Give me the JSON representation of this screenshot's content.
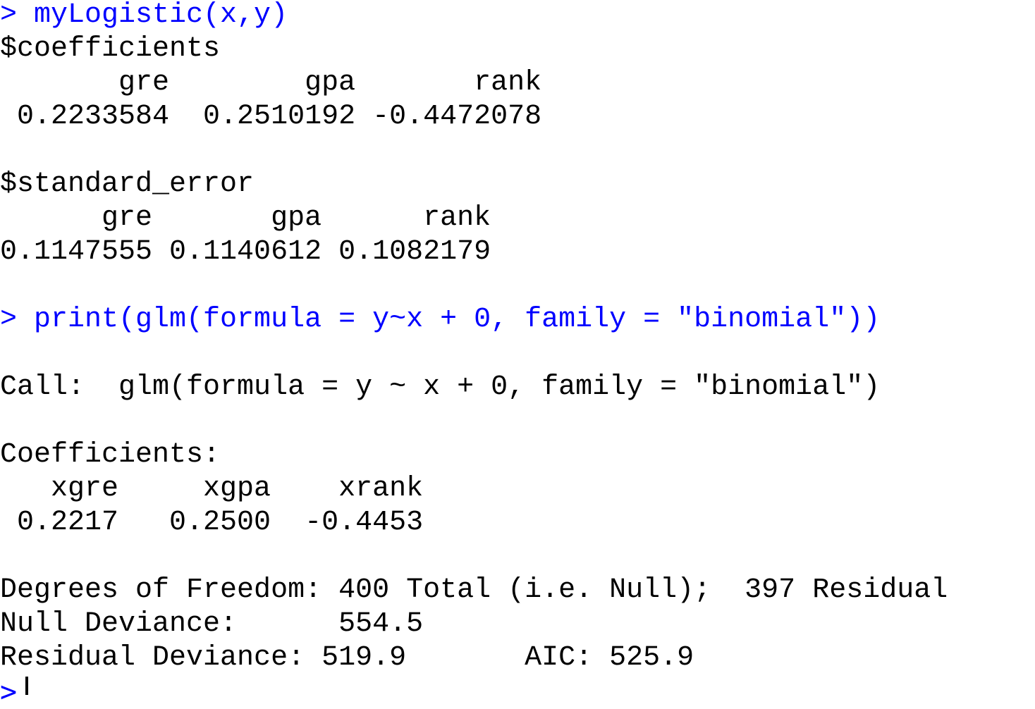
{
  "console": {
    "prompt": ">",
    "lines": [
      {
        "kind": "cmd",
        "text": "> myLogistic(x,y)"
      },
      {
        "kind": "out",
        "text": "$coefficients"
      },
      {
        "kind": "out",
        "text": "       gre        gpa       rank"
      },
      {
        "kind": "out",
        "text": " 0.2233584  0.2510192 -0.4472078"
      },
      {
        "kind": "out",
        "text": ""
      },
      {
        "kind": "out",
        "text": "$standard_error"
      },
      {
        "kind": "out",
        "text": "      gre       gpa      rank"
      },
      {
        "kind": "out",
        "text": "0.1147555 0.1140612 0.1082179"
      },
      {
        "kind": "out",
        "text": ""
      },
      {
        "kind": "cmd",
        "text": "> print(glm(formula = y~x + 0, family = \"binomial\"))"
      },
      {
        "kind": "out",
        "text": ""
      },
      {
        "kind": "out",
        "text": "Call:  glm(formula = y ~ x + 0, family = \"binomial\")"
      },
      {
        "kind": "out",
        "text": ""
      },
      {
        "kind": "out",
        "text": "Coefficients:"
      },
      {
        "kind": "out",
        "text": "   xgre     xgpa    xrank"
      },
      {
        "kind": "out",
        "text": " 0.2217   0.2500  -0.4453"
      },
      {
        "kind": "out",
        "text": ""
      },
      {
        "kind": "out",
        "text": "Degrees of Freedom: 400 Total (i.e. Null);  397 Residual"
      },
      {
        "kind": "out",
        "text": "Null Deviance:      554.5"
      },
      {
        "kind": "out",
        "text": "Residual Deviance: 519.9       AIC: 525.9"
      }
    ]
  },
  "colors": {
    "command": "#0000ff",
    "output": "#000000",
    "background": "#ffffff"
  }
}
